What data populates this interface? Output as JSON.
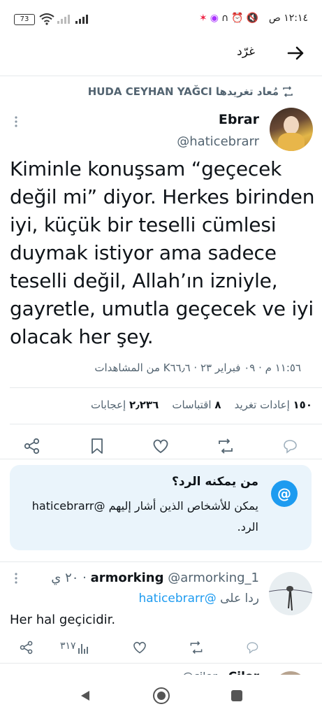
{
  "status_bar": {
    "time": "١٢:١٤ ص",
    "battery": "73",
    "wifi_icon": "wifi-icon",
    "signal_icon": "signal-icon"
  },
  "header": {
    "title": "غرّد",
    "back_icon": "arrow-right-icon"
  },
  "retweet_line": {
    "text": "مُعاد تغريدها HUDA CEYHAN YAĞCI"
  },
  "tweet": {
    "author_name": "Ebrar",
    "author_handle": "@haticebrarr",
    "text": "Kiminle konuşsam “geçecek değil mi” diyor. Herkes birinden iyi, küçük bir teselli cümlesi duymak istiyor ama sadece teselli değil, Allah’ın izniyle, gayretle, umutla geçecek ve iyi olacak her şey.",
    "meta": "١١:٥٦ م · ٠٩ فبراير ٢٣ · K٦٦٫٦ من المشاهدات",
    "stats": {
      "retweets_count": "١٥٠",
      "retweets_label": "إعادات تغريد",
      "quotes_count": "٨",
      "quotes_label": "اقتباسات",
      "likes_count": "٢٫٢٣٦",
      "likes_label": "إعجابات"
    }
  },
  "reply_prompt": {
    "title": "من يمكنه الرد؟",
    "body": "يمكن للأشخاص الذين أشار إليهم @haticebrarr الرد.",
    "icon": "@"
  },
  "reply": {
    "author_name": "armorking",
    "author_handle": "@armorking_1",
    "time": "٢٠ ي",
    "replying_to_label": "ردا على",
    "replying_to_handle": "@haticebrarr",
    "text": "Her hal geçicidir.",
    "views": "٣١٧"
  },
  "next_reply_partial": {
    "author_name": "Cilor",
    "author_handle": "@cilor"
  }
}
